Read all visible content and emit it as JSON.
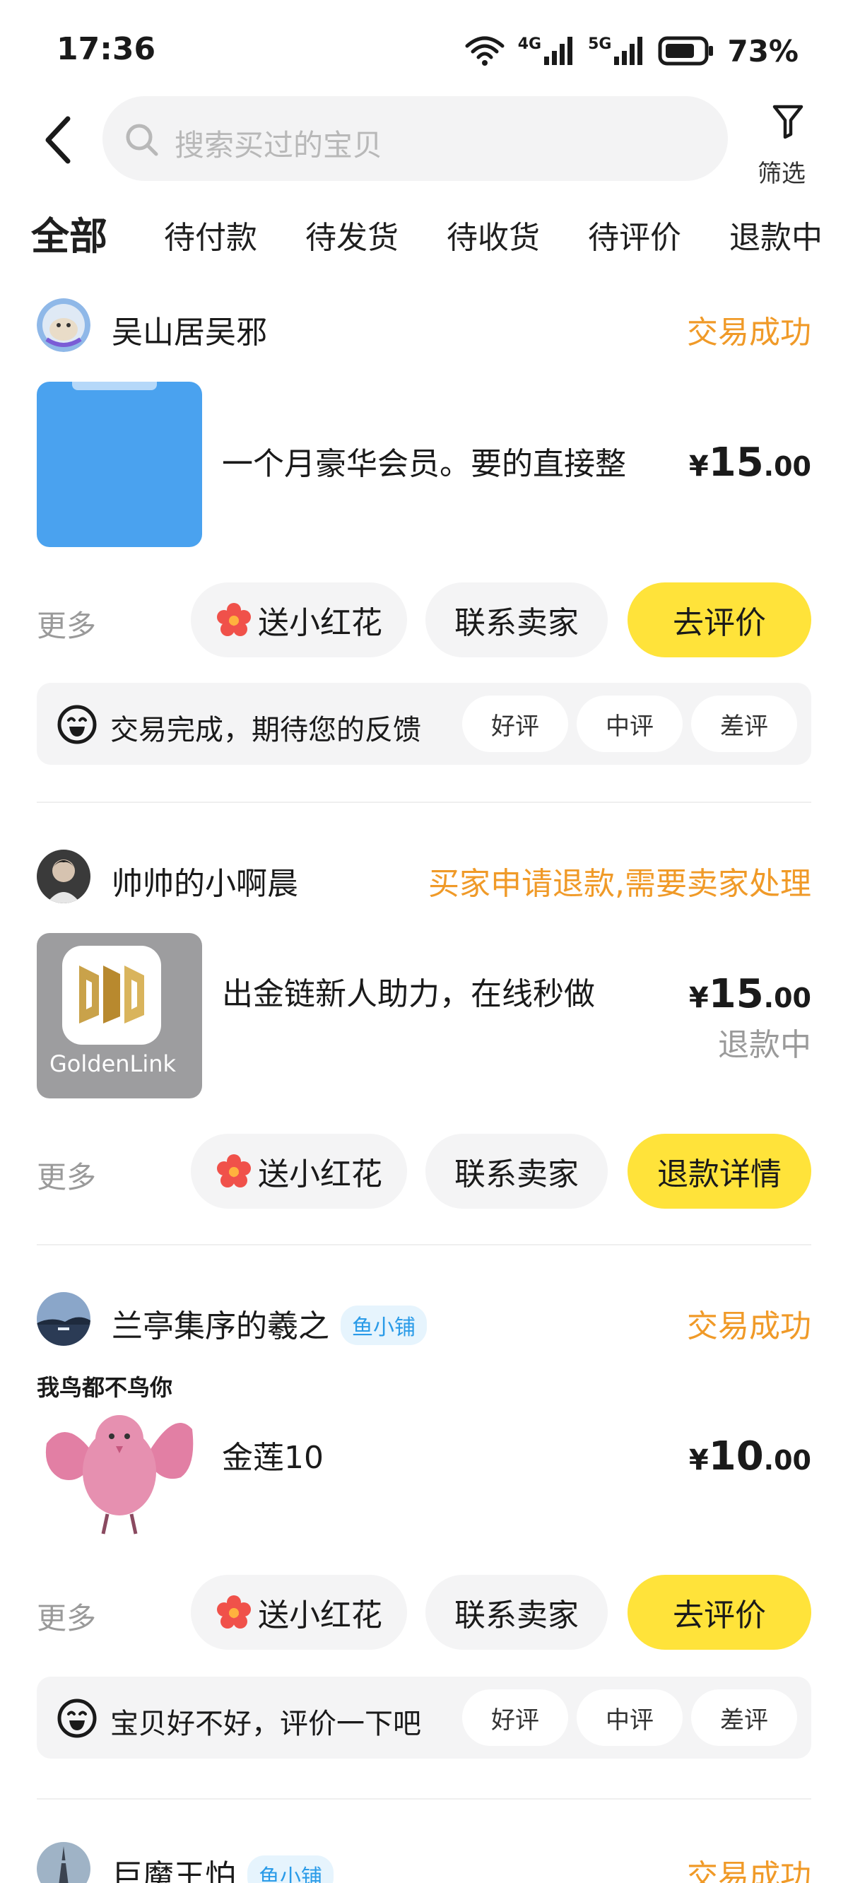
{
  "status_bar": {
    "time": "17:36",
    "battery": "73%",
    "net1": "4G",
    "net2": "5G"
  },
  "search": {
    "placeholder": "搜索买过的宝贝"
  },
  "filter": {
    "label": "筛选"
  },
  "tabs": [
    {
      "label": "全部",
      "active": true
    },
    {
      "label": "待付款"
    },
    {
      "label": "待发货"
    },
    {
      "label": "待收货"
    },
    {
      "label": "待评价"
    },
    {
      "label": "退款中"
    }
  ],
  "common": {
    "more": "更多",
    "flower": "送小红花",
    "contact": "联系卖家",
    "rate_good": "好评",
    "rate_mid": "中评",
    "rate_bad": "差评",
    "yen": "¥"
  },
  "orders": [
    {
      "shop": "吴山居吴邪",
      "status": "交易成功",
      "title": "一个月豪华会员。要的直接整",
      "price_int": "15",
      "price_dec": ".00",
      "primary_button": "去评价",
      "review_prompt": "交易完成，期待您的反馈"
    },
    {
      "shop": "帅帅的小啊晨",
      "status": "买家申请退款,需要卖家处理",
      "title": "出金链新人助力，在线秒做",
      "price_int": "15",
      "price_dec": ".00",
      "sub_status": "退款中",
      "primary_button": "退款详情",
      "thumb_text": "GoldenLink"
    },
    {
      "shop": "兰亭集序的羲之",
      "badge": "鱼小铺",
      "status": "交易成功",
      "title": "金莲10",
      "price_int": "10",
      "price_dec": ".00",
      "primary_button": "去评价",
      "review_prompt": "宝贝好不好，评价一下吧",
      "thumb_caption": "我鸟都不鸟你"
    },
    {
      "shop": "巨魔王怕",
      "badge": "鱼小铺",
      "status": "交易成功"
    }
  ],
  "colors": {
    "accent": "#ffe33a",
    "status": "#f09a28",
    "badge": "#2a9be8"
  }
}
